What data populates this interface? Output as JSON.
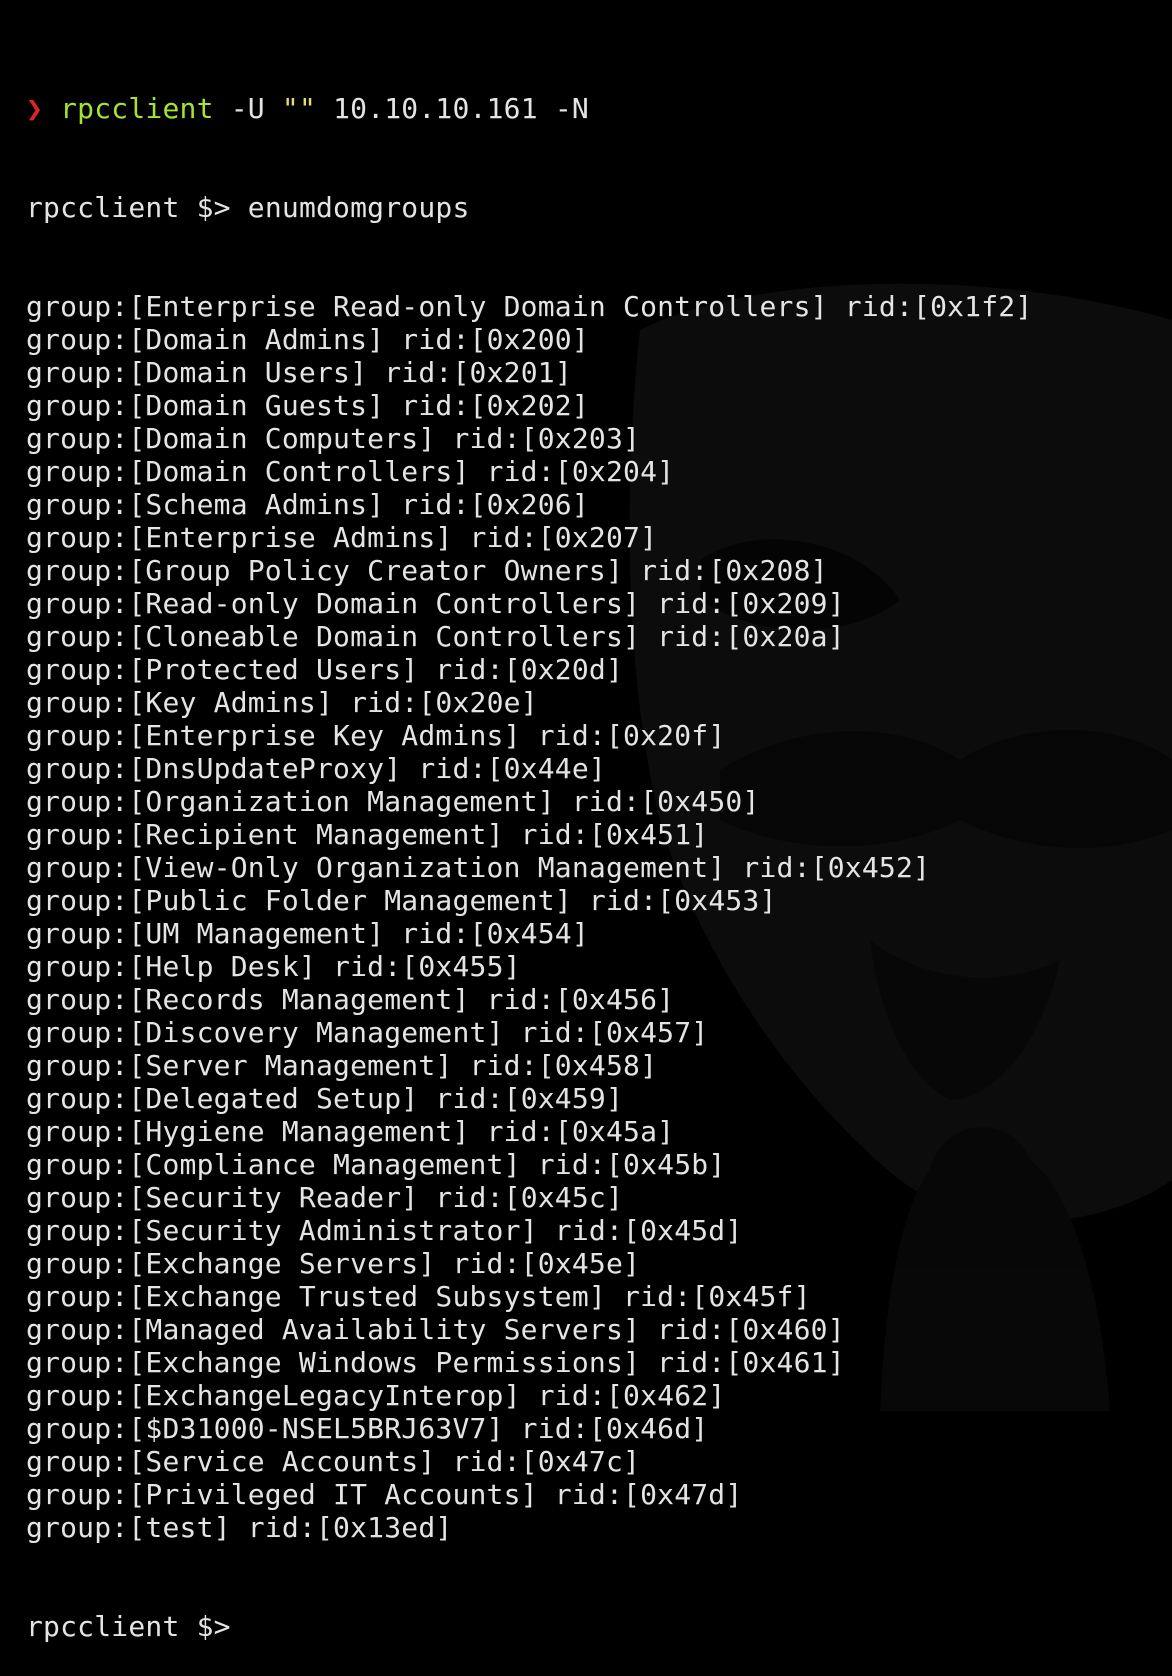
{
  "terminal": {
    "command_line": {
      "arrow": "❯",
      "program": "rpcclient",
      "arg1": " -U ",
      "quoted": "\"\"",
      "rest": " 10.10.10.161 -N"
    },
    "prompt": "rpcclient $>",
    "entered_command": "enumdomgroups",
    "groups": [
      {
        "name": "Enterprise Read-only Domain Controllers",
        "rid": "0x1f2"
      },
      {
        "name": "Domain Admins",
        "rid": "0x200"
      },
      {
        "name": "Domain Users",
        "rid": "0x201"
      },
      {
        "name": "Domain Guests",
        "rid": "0x202"
      },
      {
        "name": "Domain Computers",
        "rid": "0x203"
      },
      {
        "name": "Domain Controllers",
        "rid": "0x204"
      },
      {
        "name": "Schema Admins",
        "rid": "0x206"
      },
      {
        "name": "Enterprise Admins",
        "rid": "0x207"
      },
      {
        "name": "Group Policy Creator Owners",
        "rid": "0x208"
      },
      {
        "name": "Read-only Domain Controllers",
        "rid": "0x209"
      },
      {
        "name": "Cloneable Domain Controllers",
        "rid": "0x20a"
      },
      {
        "name": "Protected Users",
        "rid": "0x20d"
      },
      {
        "name": "Key Admins",
        "rid": "0x20e"
      },
      {
        "name": "Enterprise Key Admins",
        "rid": "0x20f"
      },
      {
        "name": "DnsUpdateProxy",
        "rid": "0x44e"
      },
      {
        "name": "Organization Management",
        "rid": "0x450"
      },
      {
        "name": "Recipient Management",
        "rid": "0x451"
      },
      {
        "name": "View-Only Organization Management",
        "rid": "0x452"
      },
      {
        "name": "Public Folder Management",
        "rid": "0x453"
      },
      {
        "name": "UM Management",
        "rid": "0x454"
      },
      {
        "name": "Help Desk",
        "rid": "0x455"
      },
      {
        "name": "Records Management",
        "rid": "0x456"
      },
      {
        "name": "Discovery Management",
        "rid": "0x457"
      },
      {
        "name": "Server Management",
        "rid": "0x458"
      },
      {
        "name": "Delegated Setup",
        "rid": "0x459"
      },
      {
        "name": "Hygiene Management",
        "rid": "0x45a"
      },
      {
        "name": "Compliance Management",
        "rid": "0x45b"
      },
      {
        "name": "Security Reader",
        "rid": "0x45c"
      },
      {
        "name": "Security Administrator",
        "rid": "0x45d"
      },
      {
        "name": "Exchange Servers",
        "rid": "0x45e"
      },
      {
        "name": "Exchange Trusted Subsystem",
        "rid": "0x45f"
      },
      {
        "name": "Managed Availability Servers",
        "rid": "0x460"
      },
      {
        "name": "Exchange Windows Permissions",
        "rid": "0x461"
      },
      {
        "name": "ExchangeLegacyInterop",
        "rid": "0x462"
      },
      {
        "name": "$D31000-NSEL5BRJ63V7",
        "rid": "0x46d"
      },
      {
        "name": "Service Accounts",
        "rid": "0x47c"
      },
      {
        "name": "Privileged IT Accounts",
        "rid": "0x47d"
      },
      {
        "name": "test",
        "rid": "0x13ed"
      }
    ],
    "final_prompt": "rpcclient $>"
  },
  "colors": {
    "background": "#000000",
    "text": "#e4e4e4",
    "prompt_arrow": "#e02424",
    "program_name": "#a6e22e",
    "quote": "#e6db74"
  }
}
